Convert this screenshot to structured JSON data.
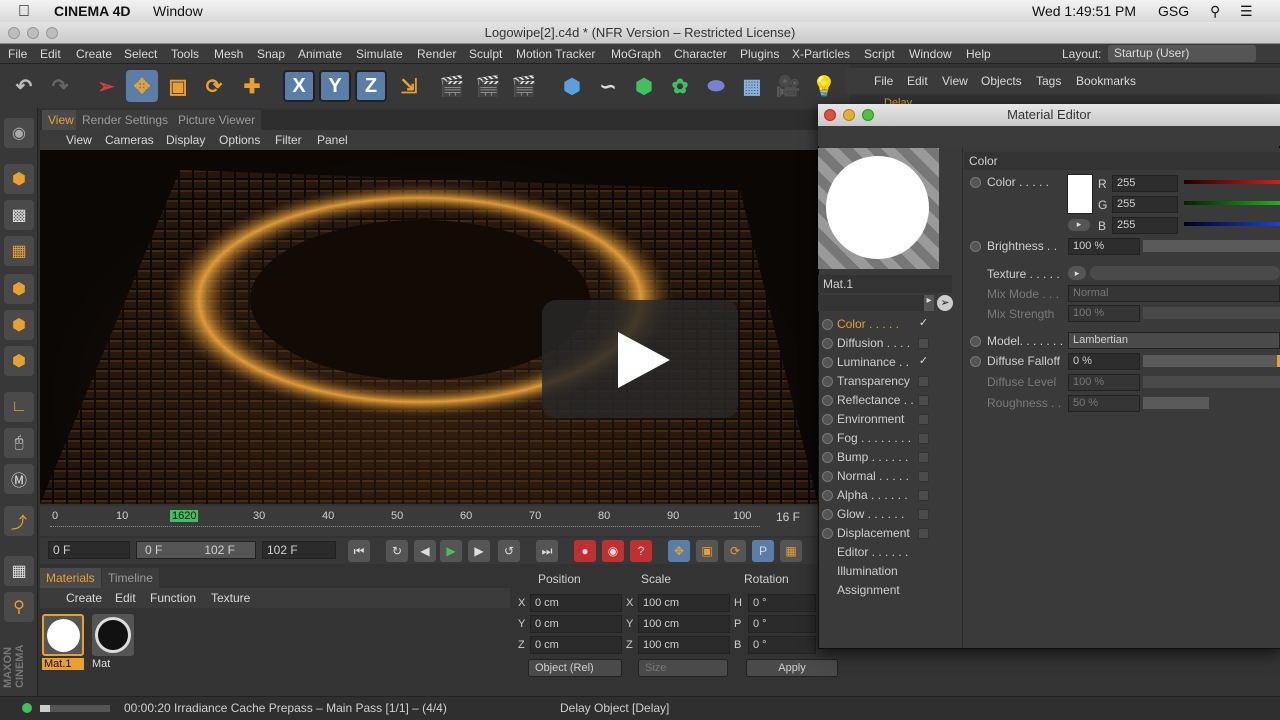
{
  "macbar": {
    "app": "CINEMA 4D",
    "window": "Window",
    "clock": "Wed 1:49:51 PM",
    "user": "GSG"
  },
  "titlebar": {
    "title": "Logowipe[2].c4d * (NFR Version – Restricted License)"
  },
  "appmenu": {
    "items": [
      "File",
      "Edit",
      "Create",
      "Select",
      "Tools",
      "Mesh",
      "Snap",
      "Animate",
      "Simulate",
      "Render",
      "Sculpt",
      "Motion Tracker",
      "MoGraph",
      "Character",
      "Plugins",
      "X-Particles",
      "Script",
      "Window",
      "Help"
    ],
    "layout_label": "Layout:",
    "layout_value": "Startup (User)"
  },
  "toolbar": {
    "x": "X",
    "y": "Y",
    "z": "Z"
  },
  "viewport": {
    "tabs": [
      "View",
      "Render Settings",
      "Picture Viewer"
    ],
    "menu": [
      "View",
      "Cameras",
      "Display",
      "Options",
      "Filter",
      "Panel"
    ]
  },
  "timeline": {
    "ticks": [
      "0",
      "10",
      "1620",
      "30",
      "40",
      "50",
      "60",
      "70",
      "80",
      "90",
      "100"
    ],
    "end_frame": "16 F"
  },
  "transport": {
    "start": "0 F",
    "range_start": "0 F",
    "range_end": "102 F",
    "end": "102 F"
  },
  "materials": {
    "tabs": [
      "Materials",
      "Timeline"
    ],
    "menu": [
      "Create",
      "Edit",
      "Function",
      "Texture"
    ],
    "items": [
      "Mat.1",
      "Mat"
    ]
  },
  "coords": {
    "headers": [
      "Position",
      "Scale",
      "Rotation"
    ],
    "rows": [
      {
        "axis": "X",
        "pos": "0 cm",
        "saxis": "X",
        "scale": "100 cm",
        "raxis": "H",
        "rot": "0 °"
      },
      {
        "axis": "Y",
        "pos": "0 cm",
        "saxis": "Y",
        "scale": "100 cm",
        "raxis": "P",
        "rot": "0 °"
      },
      {
        "axis": "Z",
        "pos": "0 cm",
        "saxis": "Z",
        "scale": "100 cm",
        "raxis": "B",
        "rot": "0 °"
      }
    ],
    "mode": "Object (Rel)",
    "size": "Size",
    "apply": "Apply"
  },
  "objects": {
    "menu": [
      "File",
      "Edit",
      "View",
      "Objects",
      "Tags",
      "Bookmarks"
    ],
    "item": "Delay"
  },
  "status": {
    "left": "00:00:20 Irradiance Cache Prepass – Main Pass [1/1] – (4/4)",
    "middle": "Delay Object [Delay]"
  },
  "material_editor": {
    "title": "Material Editor",
    "name": "Mat.1",
    "channels": [
      {
        "label": "Color . . . . .",
        "checked": true,
        "active": true
      },
      {
        "label": "Diffusion . . . .",
        "checked": false,
        "active": false
      },
      {
        "label": "Luminance . .",
        "checked": true,
        "active": false
      },
      {
        "label": "Transparency",
        "checked": false,
        "active": false
      },
      {
        "label": "Reflectance . .",
        "checked": false,
        "active": false
      },
      {
        "label": "Environment",
        "checked": false,
        "active": false
      },
      {
        "label": "Fog . . . . . . . .",
        "checked": false,
        "active": false
      },
      {
        "label": "Bump . . . . . .",
        "checked": false,
        "active": false
      },
      {
        "label": "Normal . . . . .",
        "checked": false,
        "active": false
      },
      {
        "label": "Alpha . . . . . .",
        "checked": false,
        "active": false
      },
      {
        "label": "Glow . . . . . .",
        "checked": false,
        "active": false
      },
      {
        "label": "Displacement",
        "checked": false,
        "active": false
      }
    ],
    "links": [
      "Editor . . . . . .",
      "Illumination",
      "Assignment"
    ],
    "section": "Color",
    "color_label": "Color . . . . .",
    "r_label": "R",
    "r": "255",
    "g_label": "G",
    "g": "255",
    "b_label": "B",
    "b": "255",
    "brightness_label": "Brightness . .",
    "brightness": "100 %",
    "texture_label": "Texture . . . . .",
    "mixmode_label": "Mix Mode . . .",
    "mixmode": "Normal",
    "mixstrength_label": "Mix Strength",
    "mixstrength": "100 %",
    "model_label": "Model. . . . . . .",
    "model": "Lambertian",
    "falloff_label": "Diffuse Falloff",
    "falloff": "0 %",
    "level_label": "Diffuse Level",
    "level": "100 %",
    "roughness_label": "Roughness . .",
    "roughness": "50 %"
  },
  "colors": {
    "accent": "#e8a030",
    "selected": "#5a7ea8"
  }
}
